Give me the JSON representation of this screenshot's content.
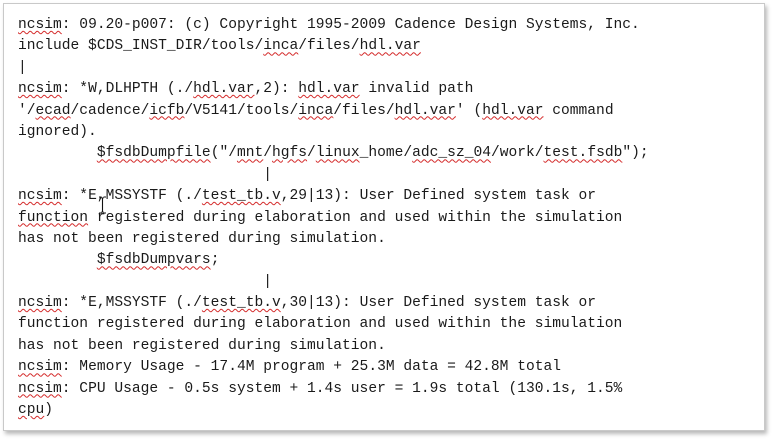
{
  "document": {
    "lines": [
      [
        {
          "t": "ncsim",
          "s": 1
        },
        {
          "t": ": 09.20-p007: (c) Copyright 1995-2009 Cadence Design Systems, Inc."
        }
      ],
      [
        {
          "t": "include $CDS_INST_DIR/tools/"
        },
        {
          "t": "inca",
          "s": 1
        },
        {
          "t": "/files/"
        },
        {
          "t": "hdl.var",
          "s": 1
        }
      ],
      [
        {
          "t": "|"
        }
      ],
      [
        {
          "t": "ncsim",
          "s": 1
        },
        {
          "t": ": *W,DLHPTH (./"
        },
        {
          "t": "hdl.var",
          "s": 1
        },
        {
          "t": ",2): "
        },
        {
          "t": "hdl.var",
          "s": 1
        },
        {
          "t": " invalid path"
        }
      ],
      [
        {
          "t": "'/"
        },
        {
          "t": "ecad",
          "s": 1
        },
        {
          "t": "/cadence/"
        },
        {
          "t": "icfb",
          "s": 1
        },
        {
          "t": "/V5141/tools/"
        },
        {
          "t": "inca",
          "s": 1
        },
        {
          "t": "/files/"
        },
        {
          "t": "hdl.var",
          "s": 1
        },
        {
          "t": "' ("
        },
        {
          "t": "hdl.var",
          "s": 1
        },
        {
          "t": " command"
        }
      ],
      [
        {
          "t": "ignored)."
        }
      ],
      [
        {
          "t": "         "
        },
        {
          "t": "$fsdbDumpfile",
          "s": 1
        },
        {
          "t": "(\"/"
        },
        {
          "t": "mnt",
          "s": 1
        },
        {
          "t": "/"
        },
        {
          "t": "hgfs",
          "s": 1
        },
        {
          "t": "/"
        },
        {
          "t": "linux",
          "s": 1
        },
        {
          "t": "_home/"
        },
        {
          "t": "adc_sz_04",
          "s": 1
        },
        {
          "t": "/work/"
        },
        {
          "t": "test.fsdb",
          "s": 1
        },
        {
          "t": "\");"
        }
      ],
      [
        {
          "t": "                            |"
        }
      ],
      [
        {
          "t": "ncsim",
          "s": 1
        },
        {
          "t": ": *E,MSSYSTF (./"
        },
        {
          "t": "test_tb.v",
          "s": 1
        },
        {
          "t": ",29|13): User Defined system task or"
        }
      ],
      [
        {
          "t": "function",
          "s": 1
        },
        {
          "t": " registered during elaboration and used within the simulation"
        }
      ],
      [
        {
          "t": "has not been registered during simulation."
        }
      ],
      [
        {
          "t": "         "
        },
        {
          "t": "$fsdbDumpvars",
          "s": 1
        },
        {
          "t": ";"
        }
      ],
      [
        {
          "t": "                            |"
        }
      ],
      [
        {
          "t": "ncsim",
          "s": 1
        },
        {
          "t": ": *E,MSSYSTF (./"
        },
        {
          "t": "test_tb.v",
          "s": 1
        },
        {
          "t": ",30|13): User Defined system task or"
        }
      ],
      [
        {
          "t": "function registered during elaboration and used within the simulation"
        }
      ],
      [
        {
          "t": "has not been registered during simulation."
        }
      ],
      [
        {
          "t": "ncsim",
          "s": 1
        },
        {
          "t": ": Memory Usage - 17.4M program + 25.3M data = 42.8M total"
        }
      ],
      [
        {
          "t": "ncsim",
          "s": 1
        },
        {
          "t": ": CPU Usage - 0.5s system + 1.4s user = 1.9s total (130.1s, 1.5%"
        }
      ],
      [
        {
          "t": "cpu",
          "s": 1
        },
        {
          "t": ")"
        }
      ]
    ]
  },
  "colors": {
    "spellcheck_underline": "#d42a2a",
    "text": "#1a1a1a",
    "background": "#ffffff"
  },
  "cursor": {
    "icon": "i-beam-cursor-icon"
  }
}
